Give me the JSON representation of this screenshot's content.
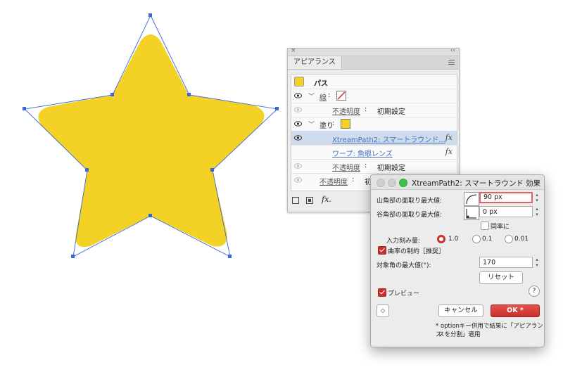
{
  "colors": {
    "star_fill": "#f4d225",
    "selection": "#3a68d8",
    "accent_red": "#c9302c"
  },
  "panel": {
    "tab_label": "アピアランス",
    "close_icon": "×",
    "collapse_icon": "‹‹",
    "rows": [
      {
        "label": "パス"
      },
      {
        "label": "線",
        "colon": ":"
      },
      {
        "label": "不透明度",
        "colon": ":",
        "value": "初期設定"
      },
      {
        "label": "塗り",
        "colon": ":"
      },
      {
        "label": "XtreamPath2: スマートラウンド..."
      },
      {
        "label": "ワープ: 魚眼レンズ"
      },
      {
        "label": "不透明度",
        "colon": ":",
        "value": "初期設定"
      },
      {
        "label": "不透明度",
        "colon": ":",
        "value": "初期設定"
      }
    ],
    "fx": "fx",
    "bottom_fx": "fx."
  },
  "dialog": {
    "title": "XtreamPath2: スマートラウンド 効果",
    "mountain_label": "山角部の面取り最大値:",
    "mountain_value": "90 px",
    "valley_label": "谷角部の面取り最大値:",
    "valley_value": "0 px",
    "same_rate_label": "同率に",
    "step_label": "入力刻み量:",
    "step_options": [
      "1.0",
      "0.1",
      "0.01"
    ],
    "curvature_label": "曲率の制約［推奨］",
    "max_angle_label": "対象角の最大値(°):",
    "max_angle_value": "170",
    "reset_label": "リセット",
    "preview_label": "プレビュー",
    "help": "?",
    "cancel_label": "キャンセル",
    "ok_label": "OK *",
    "note_line1": "* optionキー併用で結果に「アピアランス",
    "note_line2": "スを分割」適用"
  }
}
